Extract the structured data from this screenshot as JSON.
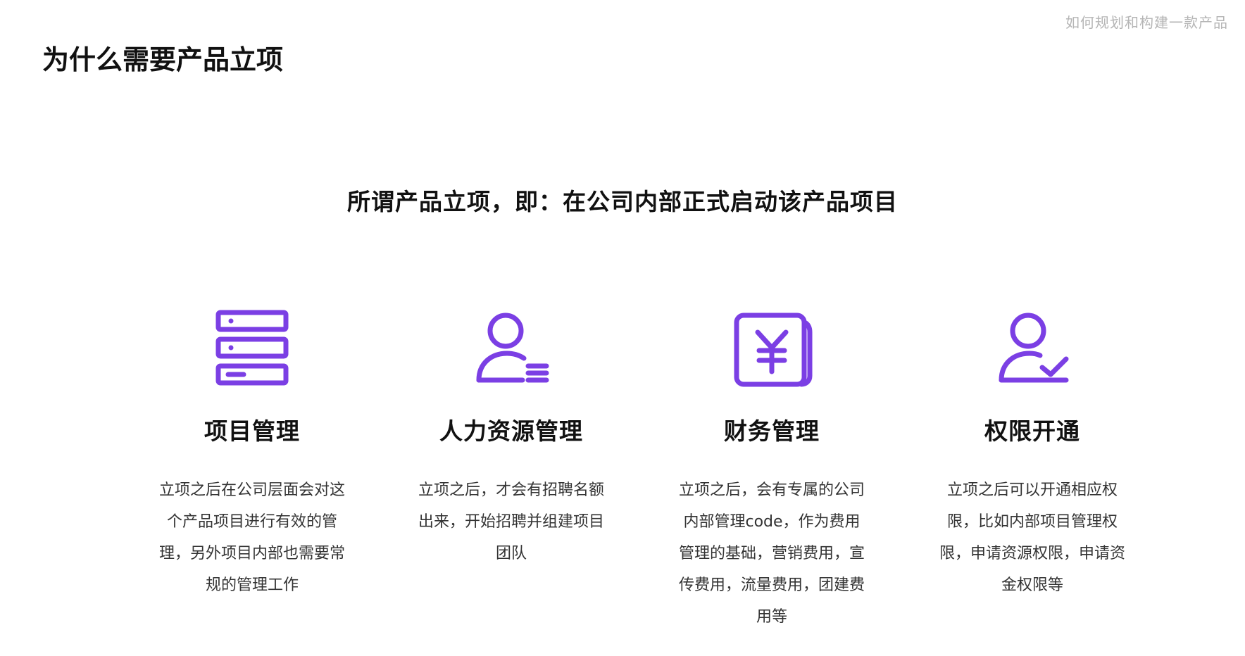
{
  "header": {
    "deck_title": "如何规划和构建一款产品",
    "page_title": "为什么需要产品立项"
  },
  "definition": "所谓产品立项，即：在公司内部正式启动该产品项目",
  "accent_color": "#7B3FE4",
  "features": [
    {
      "icon": "server-stack-icon",
      "title": "项目管理",
      "description": "立项之后在公司层面会对这个产品项目进行有效的管理，另外项目内部也需要常规的管理工作"
    },
    {
      "icon": "user-list-icon",
      "title": "人力资源管理",
      "description": "立项之后，才会有招聘名额出来，开始招聘并组建项目团队"
    },
    {
      "icon": "yen-document-icon",
      "title": "财务管理",
      "description": "立项之后，会有专属的公司内部管理code，作为费用管理的基础，营销费用，宣传费用，流量费用，团建费用等"
    },
    {
      "icon": "user-check-icon",
      "title": "权限开通",
      "description": "立项之后可以开通相应权限，比如内部项目管理权限，申请资源权限，申请资金权限等"
    }
  ]
}
